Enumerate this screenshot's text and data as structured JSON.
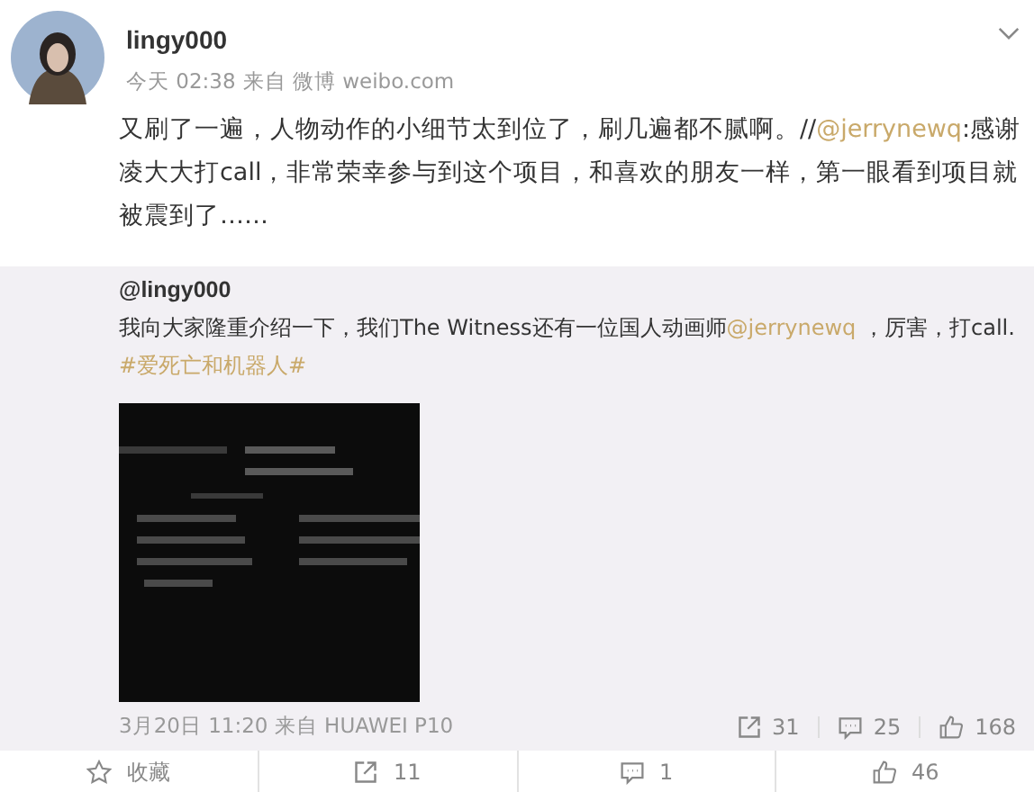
{
  "post": {
    "username": "lingy000",
    "time": "今天 02:38",
    "source": "来自 微博 weibo.com",
    "text": [
      {
        "kind": "text",
        "text": "又刷了一遍，人物动作的小细节太到位了，刷几遍都不腻啊。//"
      },
      {
        "kind": "link",
        "text": "@jerrynewq"
      },
      {
        "kind": "text",
        "text": ":感谢凌大大打call，非常荣幸参与到这个项目，和喜欢的朋友一样，第一眼看到项目就被震到了……"
      }
    ]
  },
  "repost": {
    "author": "@lingy000",
    "text": [
      {
        "kind": "text",
        "text": "我向大家隆重介绍一下，我们The Witness还有一位国人动画师"
      },
      {
        "kind": "link",
        "text": "@jerrynewq"
      },
      {
        "kind": "text",
        "text": " ，厉害，打call. "
      },
      {
        "kind": "link",
        "text": "#爱死亡和机器人#"
      }
    ],
    "time": "3月20日 11:20",
    "source": "来自 HUAWEI P10",
    "stats": [
      {
        "kind": "repost",
        "count": "31"
      },
      {
        "kind": "comment",
        "count": "25"
      },
      {
        "kind": "like",
        "count": "168"
      }
    ]
  },
  "actions": [
    {
      "kind": "favorite",
      "label": "收藏"
    },
    {
      "kind": "repost",
      "label": "11"
    },
    {
      "kind": "comment",
      "label": "1"
    },
    {
      "kind": "like",
      "label": "46"
    }
  ]
}
